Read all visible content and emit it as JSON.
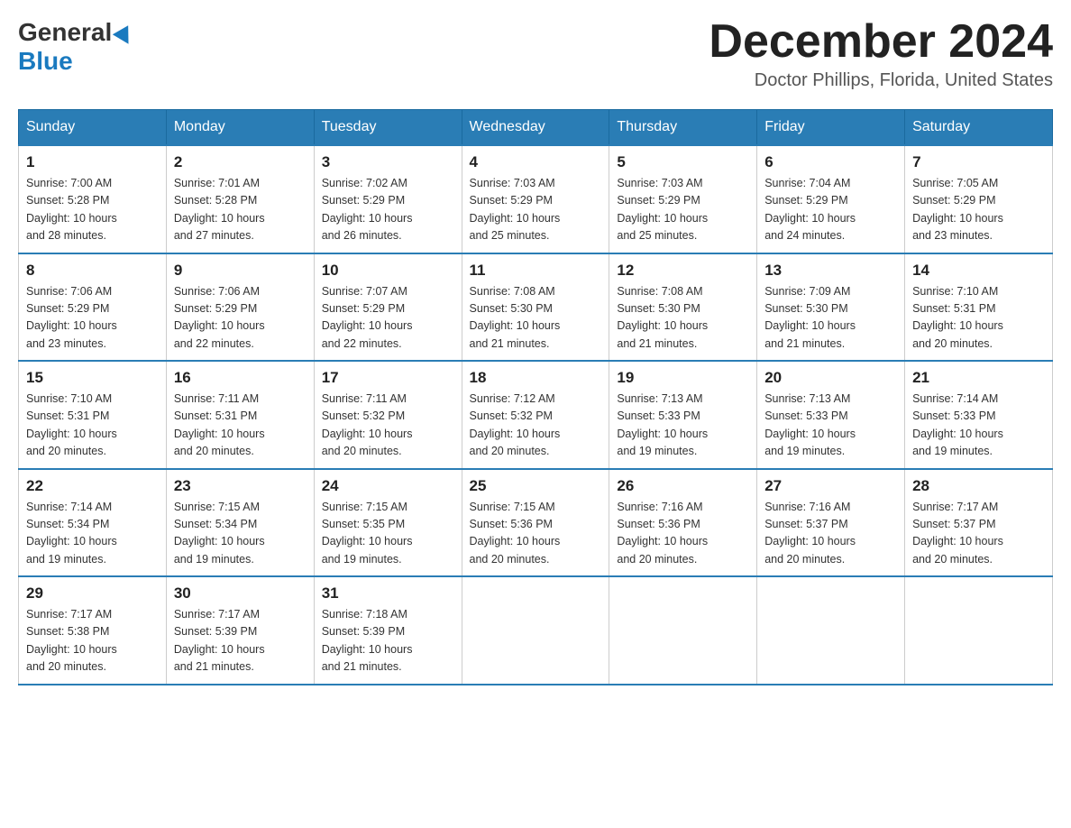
{
  "header": {
    "logo_general": "General",
    "logo_blue": "Blue",
    "month_title": "December 2024",
    "location": "Doctor Phillips, Florida, United States"
  },
  "days_of_week": [
    "Sunday",
    "Monday",
    "Tuesday",
    "Wednesday",
    "Thursday",
    "Friday",
    "Saturday"
  ],
  "weeks": [
    [
      {
        "day": "1",
        "sunrise": "7:00 AM",
        "sunset": "5:28 PM",
        "daylight": "10 hours and 28 minutes."
      },
      {
        "day": "2",
        "sunrise": "7:01 AM",
        "sunset": "5:28 PM",
        "daylight": "10 hours and 27 minutes."
      },
      {
        "day": "3",
        "sunrise": "7:02 AM",
        "sunset": "5:29 PM",
        "daylight": "10 hours and 26 minutes."
      },
      {
        "day": "4",
        "sunrise": "7:03 AM",
        "sunset": "5:29 PM",
        "daylight": "10 hours and 25 minutes."
      },
      {
        "day": "5",
        "sunrise": "7:03 AM",
        "sunset": "5:29 PM",
        "daylight": "10 hours and 25 minutes."
      },
      {
        "day": "6",
        "sunrise": "7:04 AM",
        "sunset": "5:29 PM",
        "daylight": "10 hours and 24 minutes."
      },
      {
        "day": "7",
        "sunrise": "7:05 AM",
        "sunset": "5:29 PM",
        "daylight": "10 hours and 23 minutes."
      }
    ],
    [
      {
        "day": "8",
        "sunrise": "7:06 AM",
        "sunset": "5:29 PM",
        "daylight": "10 hours and 23 minutes."
      },
      {
        "day": "9",
        "sunrise": "7:06 AM",
        "sunset": "5:29 PM",
        "daylight": "10 hours and 22 minutes."
      },
      {
        "day": "10",
        "sunrise": "7:07 AM",
        "sunset": "5:29 PM",
        "daylight": "10 hours and 22 minutes."
      },
      {
        "day": "11",
        "sunrise": "7:08 AM",
        "sunset": "5:30 PM",
        "daylight": "10 hours and 21 minutes."
      },
      {
        "day": "12",
        "sunrise": "7:08 AM",
        "sunset": "5:30 PM",
        "daylight": "10 hours and 21 minutes."
      },
      {
        "day": "13",
        "sunrise": "7:09 AM",
        "sunset": "5:30 PM",
        "daylight": "10 hours and 21 minutes."
      },
      {
        "day": "14",
        "sunrise": "7:10 AM",
        "sunset": "5:31 PM",
        "daylight": "10 hours and 20 minutes."
      }
    ],
    [
      {
        "day": "15",
        "sunrise": "7:10 AM",
        "sunset": "5:31 PM",
        "daylight": "10 hours and 20 minutes."
      },
      {
        "day": "16",
        "sunrise": "7:11 AM",
        "sunset": "5:31 PM",
        "daylight": "10 hours and 20 minutes."
      },
      {
        "day": "17",
        "sunrise": "7:11 AM",
        "sunset": "5:32 PM",
        "daylight": "10 hours and 20 minutes."
      },
      {
        "day": "18",
        "sunrise": "7:12 AM",
        "sunset": "5:32 PM",
        "daylight": "10 hours and 20 minutes."
      },
      {
        "day": "19",
        "sunrise": "7:13 AM",
        "sunset": "5:33 PM",
        "daylight": "10 hours and 19 minutes."
      },
      {
        "day": "20",
        "sunrise": "7:13 AM",
        "sunset": "5:33 PM",
        "daylight": "10 hours and 19 minutes."
      },
      {
        "day": "21",
        "sunrise": "7:14 AM",
        "sunset": "5:33 PM",
        "daylight": "10 hours and 19 minutes."
      }
    ],
    [
      {
        "day": "22",
        "sunrise": "7:14 AM",
        "sunset": "5:34 PM",
        "daylight": "10 hours and 19 minutes."
      },
      {
        "day": "23",
        "sunrise": "7:15 AM",
        "sunset": "5:34 PM",
        "daylight": "10 hours and 19 minutes."
      },
      {
        "day": "24",
        "sunrise": "7:15 AM",
        "sunset": "5:35 PM",
        "daylight": "10 hours and 19 minutes."
      },
      {
        "day": "25",
        "sunrise": "7:15 AM",
        "sunset": "5:36 PM",
        "daylight": "10 hours and 20 minutes."
      },
      {
        "day": "26",
        "sunrise": "7:16 AM",
        "sunset": "5:36 PM",
        "daylight": "10 hours and 20 minutes."
      },
      {
        "day": "27",
        "sunrise": "7:16 AM",
        "sunset": "5:37 PM",
        "daylight": "10 hours and 20 minutes."
      },
      {
        "day": "28",
        "sunrise": "7:17 AM",
        "sunset": "5:37 PM",
        "daylight": "10 hours and 20 minutes."
      }
    ],
    [
      {
        "day": "29",
        "sunrise": "7:17 AM",
        "sunset": "5:38 PM",
        "daylight": "10 hours and 20 minutes."
      },
      {
        "day": "30",
        "sunrise": "7:17 AM",
        "sunset": "5:39 PM",
        "daylight": "10 hours and 21 minutes."
      },
      {
        "day": "31",
        "sunrise": "7:18 AM",
        "sunset": "5:39 PM",
        "daylight": "10 hours and 21 minutes."
      },
      null,
      null,
      null,
      null
    ]
  ],
  "labels": {
    "sunrise": "Sunrise:",
    "sunset": "Sunset:",
    "daylight": "Daylight:"
  }
}
